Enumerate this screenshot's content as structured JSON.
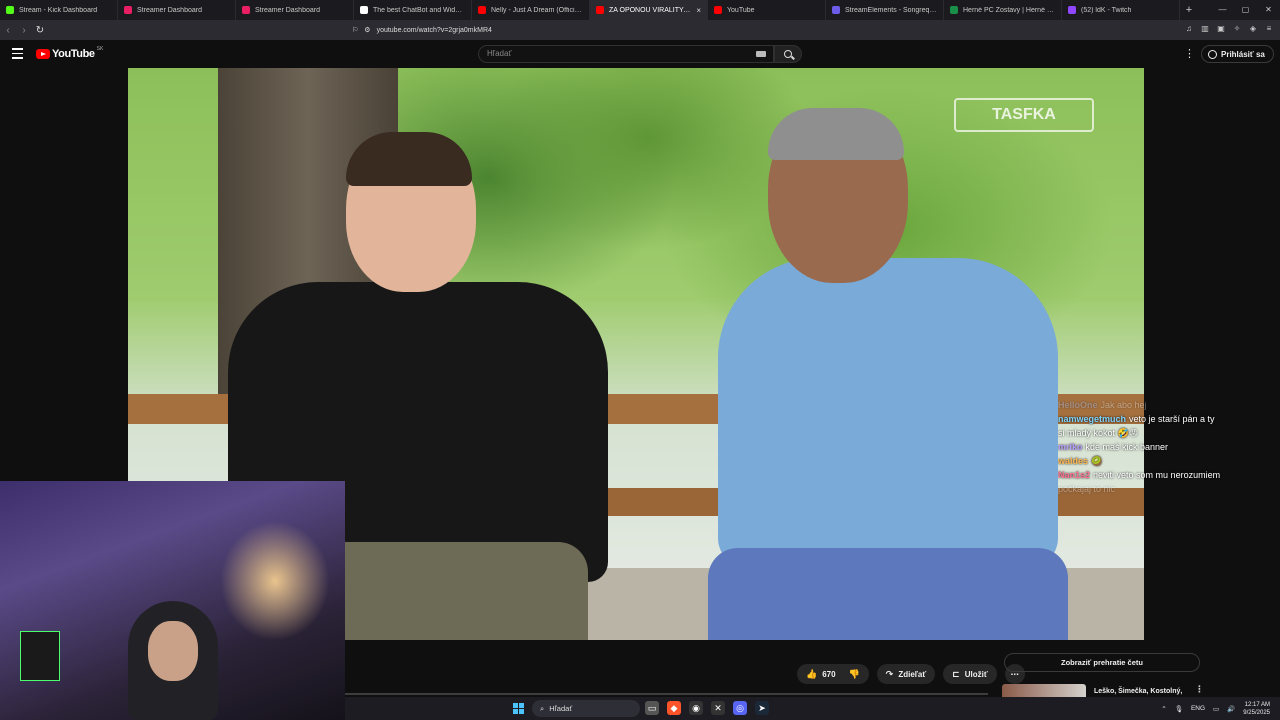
{
  "browser": {
    "tabs": [
      {
        "title": "Stream - Kick Dashboard",
        "color": "#53fc18"
      },
      {
        "title": "Streamer Dashboard",
        "color": "#e91e63"
      },
      {
        "title": "Streamer Dashboard",
        "color": "#e91e63"
      },
      {
        "title": "The best ChatBot and Widgets fo",
        "color": "#ffffff"
      },
      {
        "title": "Nelly - Just A Dream (Official Musi",
        "color": "#ff0000"
      },
      {
        "title": "ZA OPONOU VIRALITY: VI..",
        "color": "#ff0000",
        "active": true
      },
      {
        "title": "YouTube",
        "color": "#ff0000"
      },
      {
        "title": "StreamElements - Songrequest",
        "color": "#6c5ce7"
      },
      {
        "title": "Herné PC Zostavy | Herné počítač",
        "color": "#1a8f4a"
      },
      {
        "title": "(52) ldK - Twitch",
        "color": "#9146ff"
      }
    ],
    "new_tab": "+",
    "close_tab": "×",
    "url": "youtube.com/watch?v=2grja0mkMR4"
  },
  "youtube": {
    "logo_text": "YouTube",
    "region": "SK",
    "search_placeholder": "Hľadať",
    "signin_label": "Prihlásiť sa"
  },
  "video": {
    "watermark": "TASFKA"
  },
  "chat": [
    {
      "user": "HelloOne",
      "text": "Jak abo hej",
      "color": "#9ec1ff",
      "faint": true
    },
    {
      "user": "namwegetmuch",
      "text": "veto je starší pán a ty",
      "color": "#7dd3ff"
    },
    {
      "user": "",
      "text": "si mladý kokot 🤣😡",
      "color": "#ffffff"
    },
    {
      "user": "mriko",
      "text": "kde maš kick banner",
      "color": "#b69cff"
    },
    {
      "user": "waldes",
      "text": "🥝",
      "color": "#ffb74d"
    },
    {
      "user": "Nan1s2",
      "text": "neviti veto som mu nerozumiem",
      "color": "#ff6f91"
    },
    {
      "user": "",
      "text": "počkajaj to nic",
      "color": "#ffffff",
      "faint": true
    }
  ],
  "actions": {
    "likes": "670",
    "share": "Zdieľať",
    "save": "Uložiť",
    "more": "⋯",
    "show_chat": "Zobraziť prehratie četu",
    "recommendation_title": "Leško, Šimečka, Kostolný,"
  },
  "taskbar": {
    "search_label": "Hľadať",
    "lang": "ENG",
    "time": "12:17 AM",
    "date": "9/25/2025"
  }
}
